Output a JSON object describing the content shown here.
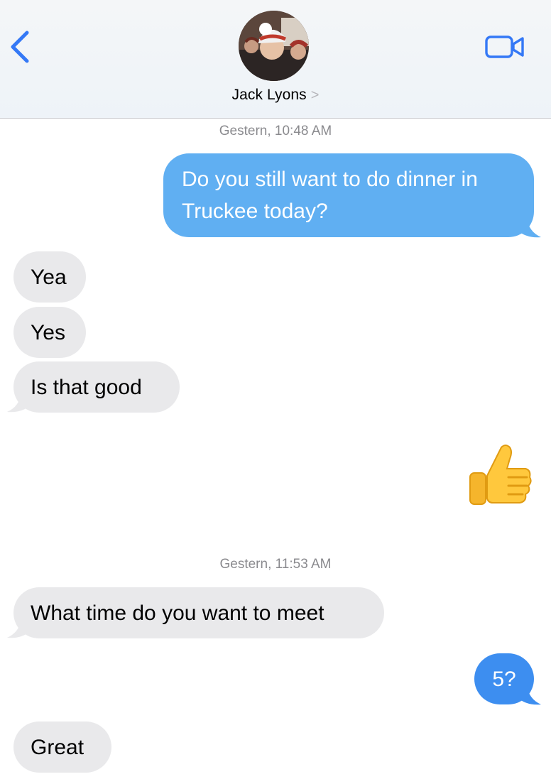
{
  "header": {
    "contact_name": "Jack Lyons",
    "contact_chevron": ">",
    "back_icon": "chevron-left-icon",
    "video_icon": "video-camera-icon",
    "accent_color": "#3478f6"
  },
  "conversation": {
    "timestamp_1": "Gestern, 10:48 AM",
    "msg_sent_1": "Do you still want to do dinner in Truckee today?",
    "msg_recv_1": "Yea",
    "msg_recv_2": "Yes",
    "msg_recv_3": "Is that good",
    "reaction_emoji": "thumbs-up-icon",
    "timestamp_2": "Gestern, 11:53 AM",
    "msg_recv_4": "What time do you want to meet",
    "msg_sent_2": "5?",
    "msg_recv_5": "Great"
  },
  "colors": {
    "sent_bubble": "#60aff2",
    "sent_bubble_last": "#3d8ef0",
    "received_bubble": "#e9e9eb"
  }
}
